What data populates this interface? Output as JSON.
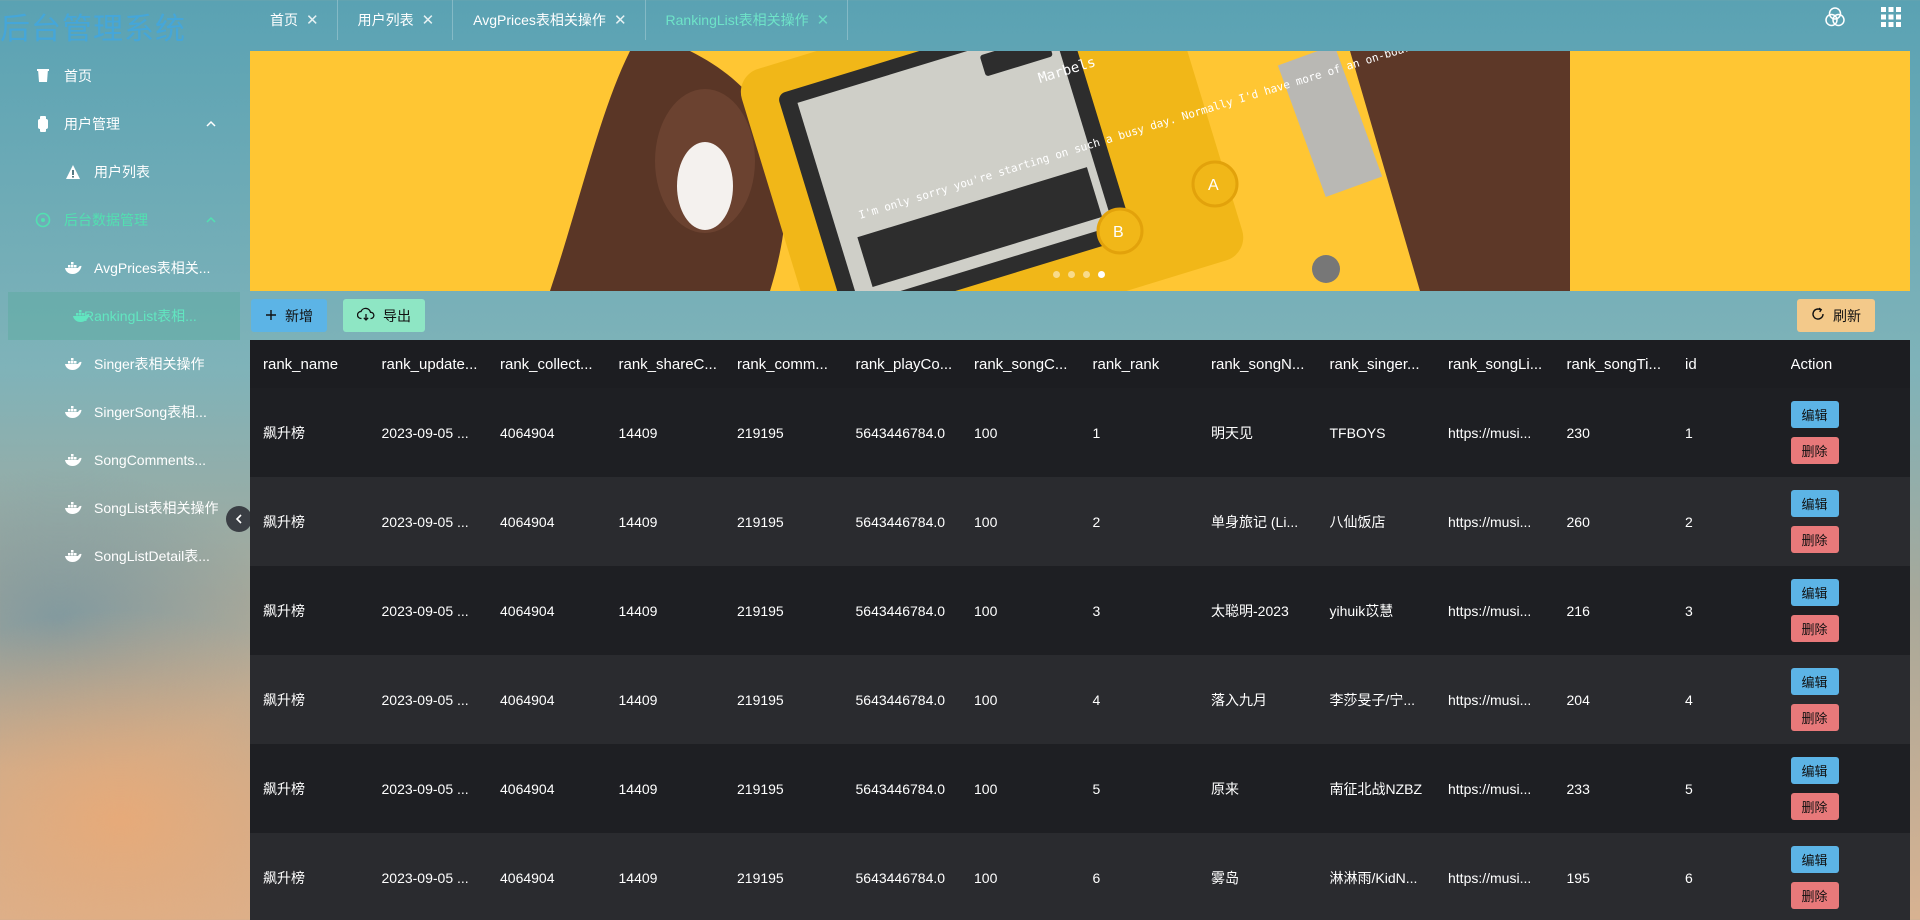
{
  "app": {
    "title": "后台管理系统"
  },
  "sidebar": {
    "items": [
      {
        "label": "首页"
      },
      {
        "label": "用户管理"
      },
      {
        "label": "用户列表"
      },
      {
        "label": "后台数据管理"
      },
      {
        "label": "AvgPrices表相关..."
      },
      {
        "label": "RankingList表相..."
      },
      {
        "label": "Singer表相关操作"
      },
      {
        "label": "SingerSong表相..."
      },
      {
        "label": "SongComments..."
      },
      {
        "label": "SongList表相关操作"
      },
      {
        "label": "SongListDetail表..."
      }
    ]
  },
  "tabs": [
    {
      "label": "首页"
    },
    {
      "label": "用户列表"
    },
    {
      "label": "AvgPrices表相关操作"
    },
    {
      "label": "RankingList表相关操作"
    }
  ],
  "toolbar": {
    "add_label": "新增",
    "export_label": "导出",
    "refresh_label": "刷新"
  },
  "table": {
    "columns": [
      "rank_name",
      "rank_update...",
      "rank_collect...",
      "rank_shareC...",
      "rank_comm...",
      "rank_playCo...",
      "rank_songC...",
      "rank_rank",
      "rank_songN...",
      "rank_singer...",
      "rank_songLi...",
      "rank_songTi...",
      "id",
      "Action"
    ],
    "edit_label": "编辑",
    "delete_label": "删除",
    "rows": [
      [
        "飙升榜",
        "2023-09-05 ...",
        "4064904",
        "14409",
        "219195",
        "5643446784.0",
        "100",
        "1",
        "明天见",
        "TFBOYS",
        "https://musi...",
        "230",
        "1"
      ],
      [
        "飙升榜",
        "2023-09-05 ...",
        "4064904",
        "14409",
        "219195",
        "5643446784.0",
        "100",
        "2",
        "单身旅记 (Li...",
        "八仙饭店",
        "https://musi...",
        "260",
        "2"
      ],
      [
        "飙升榜",
        "2023-09-05 ...",
        "4064904",
        "14409",
        "219195",
        "5643446784.0",
        "100",
        "3",
        "太聪明-2023",
        "yihuik苡慧",
        "https://musi...",
        "216",
        "3"
      ],
      [
        "飙升榜",
        "2023-09-05 ...",
        "4064904",
        "14409",
        "219195",
        "5643446784.0",
        "100",
        "4",
        "落入九月",
        "李莎旻子/宁...",
        "https://musi...",
        "204",
        "4"
      ],
      [
        "飙升榜",
        "2023-09-05 ...",
        "4064904",
        "14409",
        "219195",
        "5643446784.0",
        "100",
        "5",
        "原来",
        "南征北战NZBZ",
        "https://musi...",
        "233",
        "5"
      ],
      [
        "飙升榜",
        "2023-09-05 ...",
        "4064904",
        "14409",
        "219195",
        "5643446784.0",
        "100",
        "6",
        "雾岛",
        "淋淋雨/KidN...",
        "https://musi...",
        "195",
        "6"
      ]
    ]
  },
  "banner": {
    "screen_text": "I'm only sorry you're starting on such a busy day. Normally I'd have more of an on-boarding.",
    "tag_text": "Marbels",
    "button_a": "A",
    "button_b": "B"
  },
  "colors": {
    "accent": "#45a6d9",
    "active": "#62e6c0",
    "edit": "#5cb4e6",
    "delete": "#e8797a",
    "banner": "#ffc633"
  },
  "icons": [
    "cup-icon",
    "watch-icon",
    "warning-icon",
    "dashboard-icon",
    "docker-icon",
    "chevron-up-icon",
    "close-icon",
    "theme-icon",
    "grid-icon",
    "plus-icon",
    "cloud-download-icon",
    "refresh-icon",
    "chevron-left-icon"
  ]
}
